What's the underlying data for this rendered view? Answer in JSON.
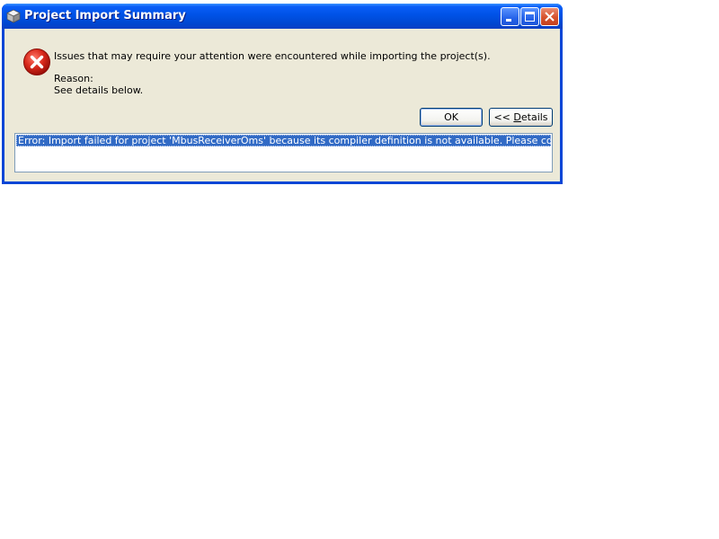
{
  "window": {
    "title": "Project Import Summary",
    "icon": "app-cube-icon"
  },
  "titlebar_buttons": {
    "minimize": "minimize-icon",
    "maximize": "maximize-icon",
    "close": "close-icon"
  },
  "dialog": {
    "icon": "error-icon",
    "message": "Issues that may require your attention were encountered while importing the project(s).",
    "reason_label": "Reason:",
    "reason_text": "See details below."
  },
  "buttons": {
    "ok_label": "OK",
    "details_prefix": "<< ",
    "details_mnemonic": "D",
    "details_rest": "etails"
  },
  "details_list": {
    "items": [
      "Error: Import failed for project 'MbusReceiverOms' because its compiler definition is not available. Please contact support."
    ]
  },
  "colors": {
    "titlebar": "#0052e6",
    "client_bg": "#ece9d8",
    "selection": "#316ac5",
    "error_red": "#d92a1c"
  }
}
